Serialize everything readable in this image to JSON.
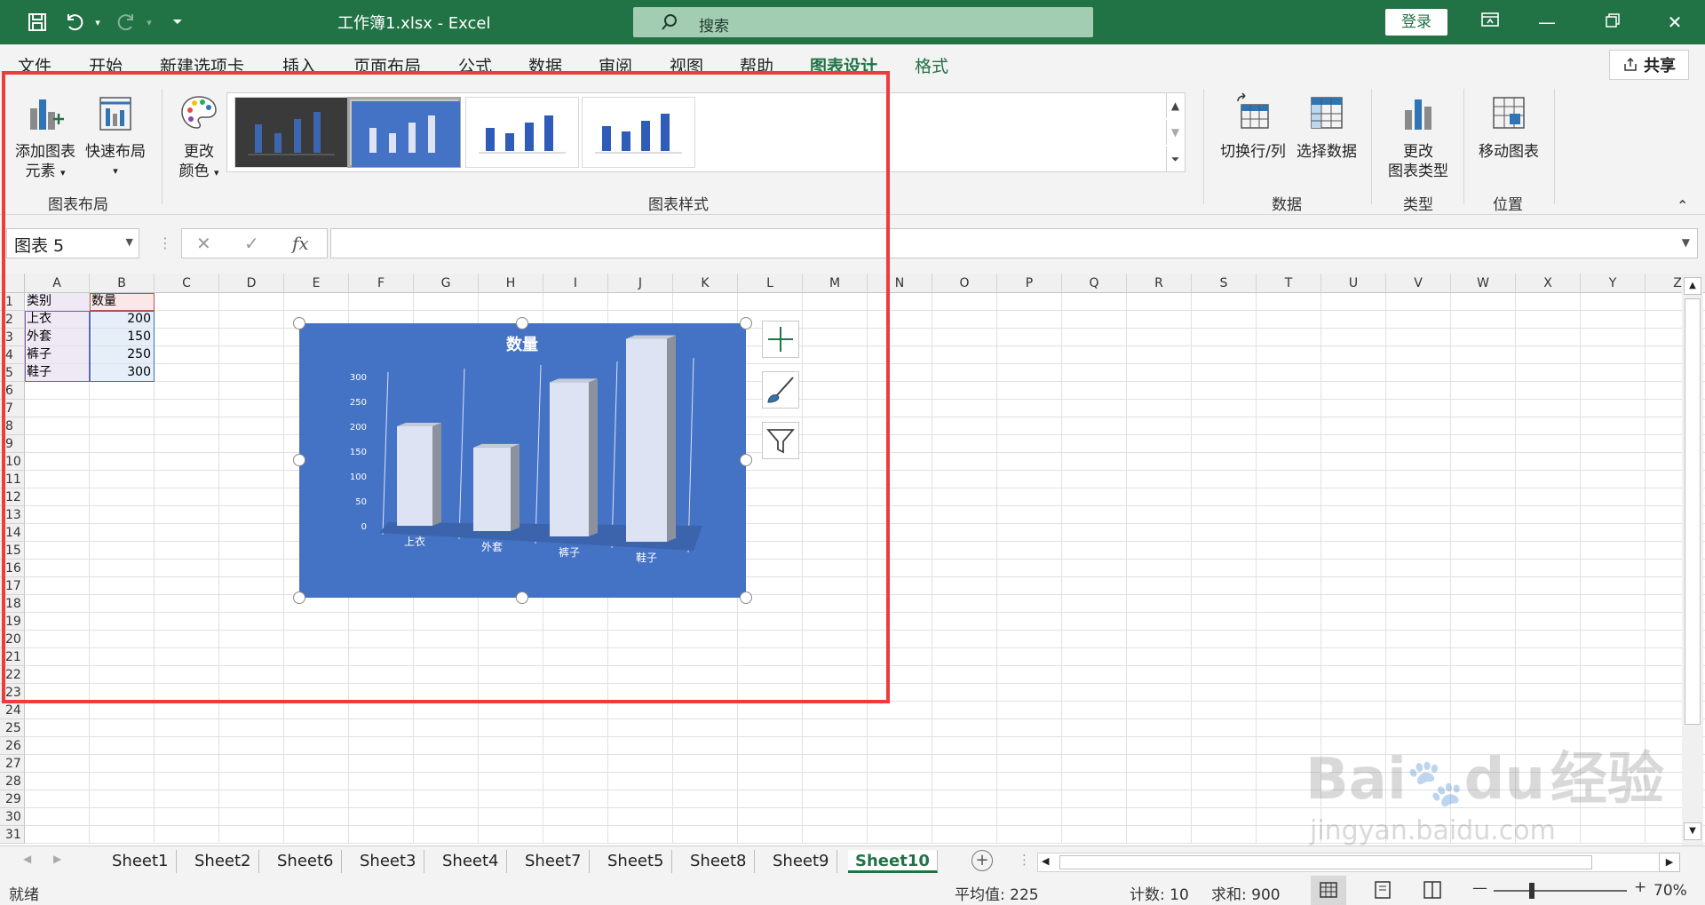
{
  "titlebar": {
    "doc_title": "工作簿1.xlsx  -  Excel",
    "search_placeholder": "搜索",
    "login_label": "登录"
  },
  "ribbon_tabs": [
    "文件",
    "开始",
    "新建选项卡",
    "插入",
    "页面布局",
    "公式",
    "数据",
    "审阅",
    "视图",
    "帮助",
    "图表设计",
    "格式"
  ],
  "active_tab": "图表设计",
  "share_label": "共享",
  "ribbon": {
    "add_element_l1": "添加图表",
    "add_element_l2": "元素",
    "quick_layout": "快速布局",
    "change_color_l1": "更改",
    "change_color_l2": "颜色",
    "group_chart_layout": "图表布局",
    "group_chart_styles": "图表样式",
    "switch_row_col": "切换行/列",
    "select_data": "选择数据",
    "change_type_l1": "更改",
    "change_type_l2": "图表类型",
    "move_chart": "移动图表",
    "group_data": "数据",
    "group_type": "类型",
    "group_position": "位置"
  },
  "formula_bar": {
    "name_box": "图表 5",
    "fx": "fx",
    "formula_value": ""
  },
  "columns": [
    "A",
    "B",
    "C",
    "D",
    "E",
    "F",
    "G",
    "H",
    "I",
    "J",
    "K",
    "L",
    "M",
    "N",
    "O",
    "P",
    "Q",
    "R",
    "S",
    "T",
    "U",
    "V",
    "W",
    "X",
    "Y",
    "Z"
  ],
  "row_count": 31,
  "sheet_data": {
    "header": [
      "类别",
      "数量"
    ],
    "rows": [
      [
        "上衣",
        "200"
      ],
      [
        "外套",
        "150"
      ],
      [
        "裤子",
        "250"
      ],
      [
        "鞋子",
        "300"
      ]
    ]
  },
  "chart_data": {
    "type": "bar",
    "title": "数量",
    "categories": [
      "上衣",
      "外套",
      "裤子",
      "鞋子"
    ],
    "values": [
      200,
      150,
      250,
      300
    ],
    "yticks": [
      "0",
      "50",
      "100",
      "150",
      "200",
      "250",
      "300"
    ],
    "ylim": [
      0,
      300
    ],
    "colors": {
      "background": "#4472c4",
      "bar": "#dde3f3",
      "bar_side": "#8b929e"
    }
  },
  "sheet_tabs": [
    "Sheet1",
    "Sheet2",
    "Sheet6",
    "Sheet3",
    "Sheet4",
    "Sheet7",
    "Sheet5",
    "Sheet8",
    "Sheet9",
    "Sheet10"
  ],
  "active_sheet": "Sheet10",
  "status": {
    "ready": "就绪",
    "average": "平均值: 225",
    "count": "计数: 10",
    "sum": "求和: 900",
    "zoom": "70%"
  },
  "watermark": {
    "brand": "Bai",
    "brand2": "du",
    "cn": "经验",
    "url": "jingyan.baidu.com"
  },
  "colors": {
    "excel_green": "#217346",
    "annotation_red": "#f03b3b"
  }
}
